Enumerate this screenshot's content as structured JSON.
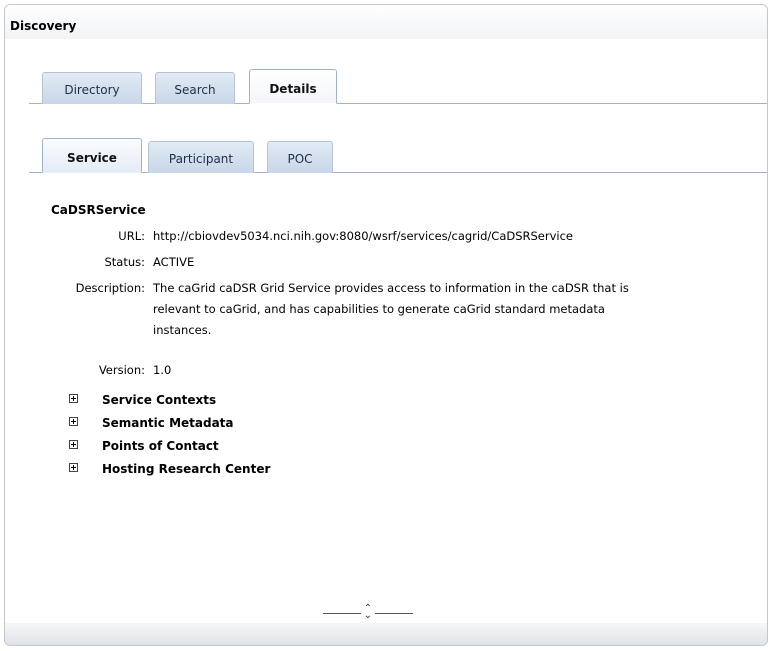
{
  "panel": {
    "title": "Discovery"
  },
  "main_tabs": [
    {
      "label": "Directory",
      "active": false
    },
    {
      "label": "Search",
      "active": false
    },
    {
      "label": "Details",
      "active": true
    }
  ],
  "sub_tabs": [
    {
      "label": "Service",
      "active": true
    },
    {
      "label": "Participant",
      "active": false
    },
    {
      "label": "POC",
      "active": false
    }
  ],
  "service": {
    "name": "CaDSRService",
    "url_label": "URL:",
    "url": "http://cbiovdev5034.nci.nih.gov:8080/wsrf/services/cagrid/CaDSRService",
    "status_label": "Status:",
    "status": "ACTIVE",
    "description_label": "Description:",
    "description_lines": [
      "The caGrid caDSR Grid Service provides access to information in the caDSR that is",
      "relevant to caGrid, and has capabilities to generate caGrid standard metadata",
      "instances."
    ],
    "version_label": "Version:",
    "version": "1.0"
  },
  "tree": [
    {
      "label": "Service Contexts"
    },
    {
      "label": "Semantic Metadata"
    },
    {
      "label": "Points of Contact"
    },
    {
      "label": "Hosting Research Center"
    }
  ],
  "colors": {
    "tab_line": "#9fb3cc",
    "tab_bg": "#c8d6e8",
    "border": "#c3c7cc"
  }
}
